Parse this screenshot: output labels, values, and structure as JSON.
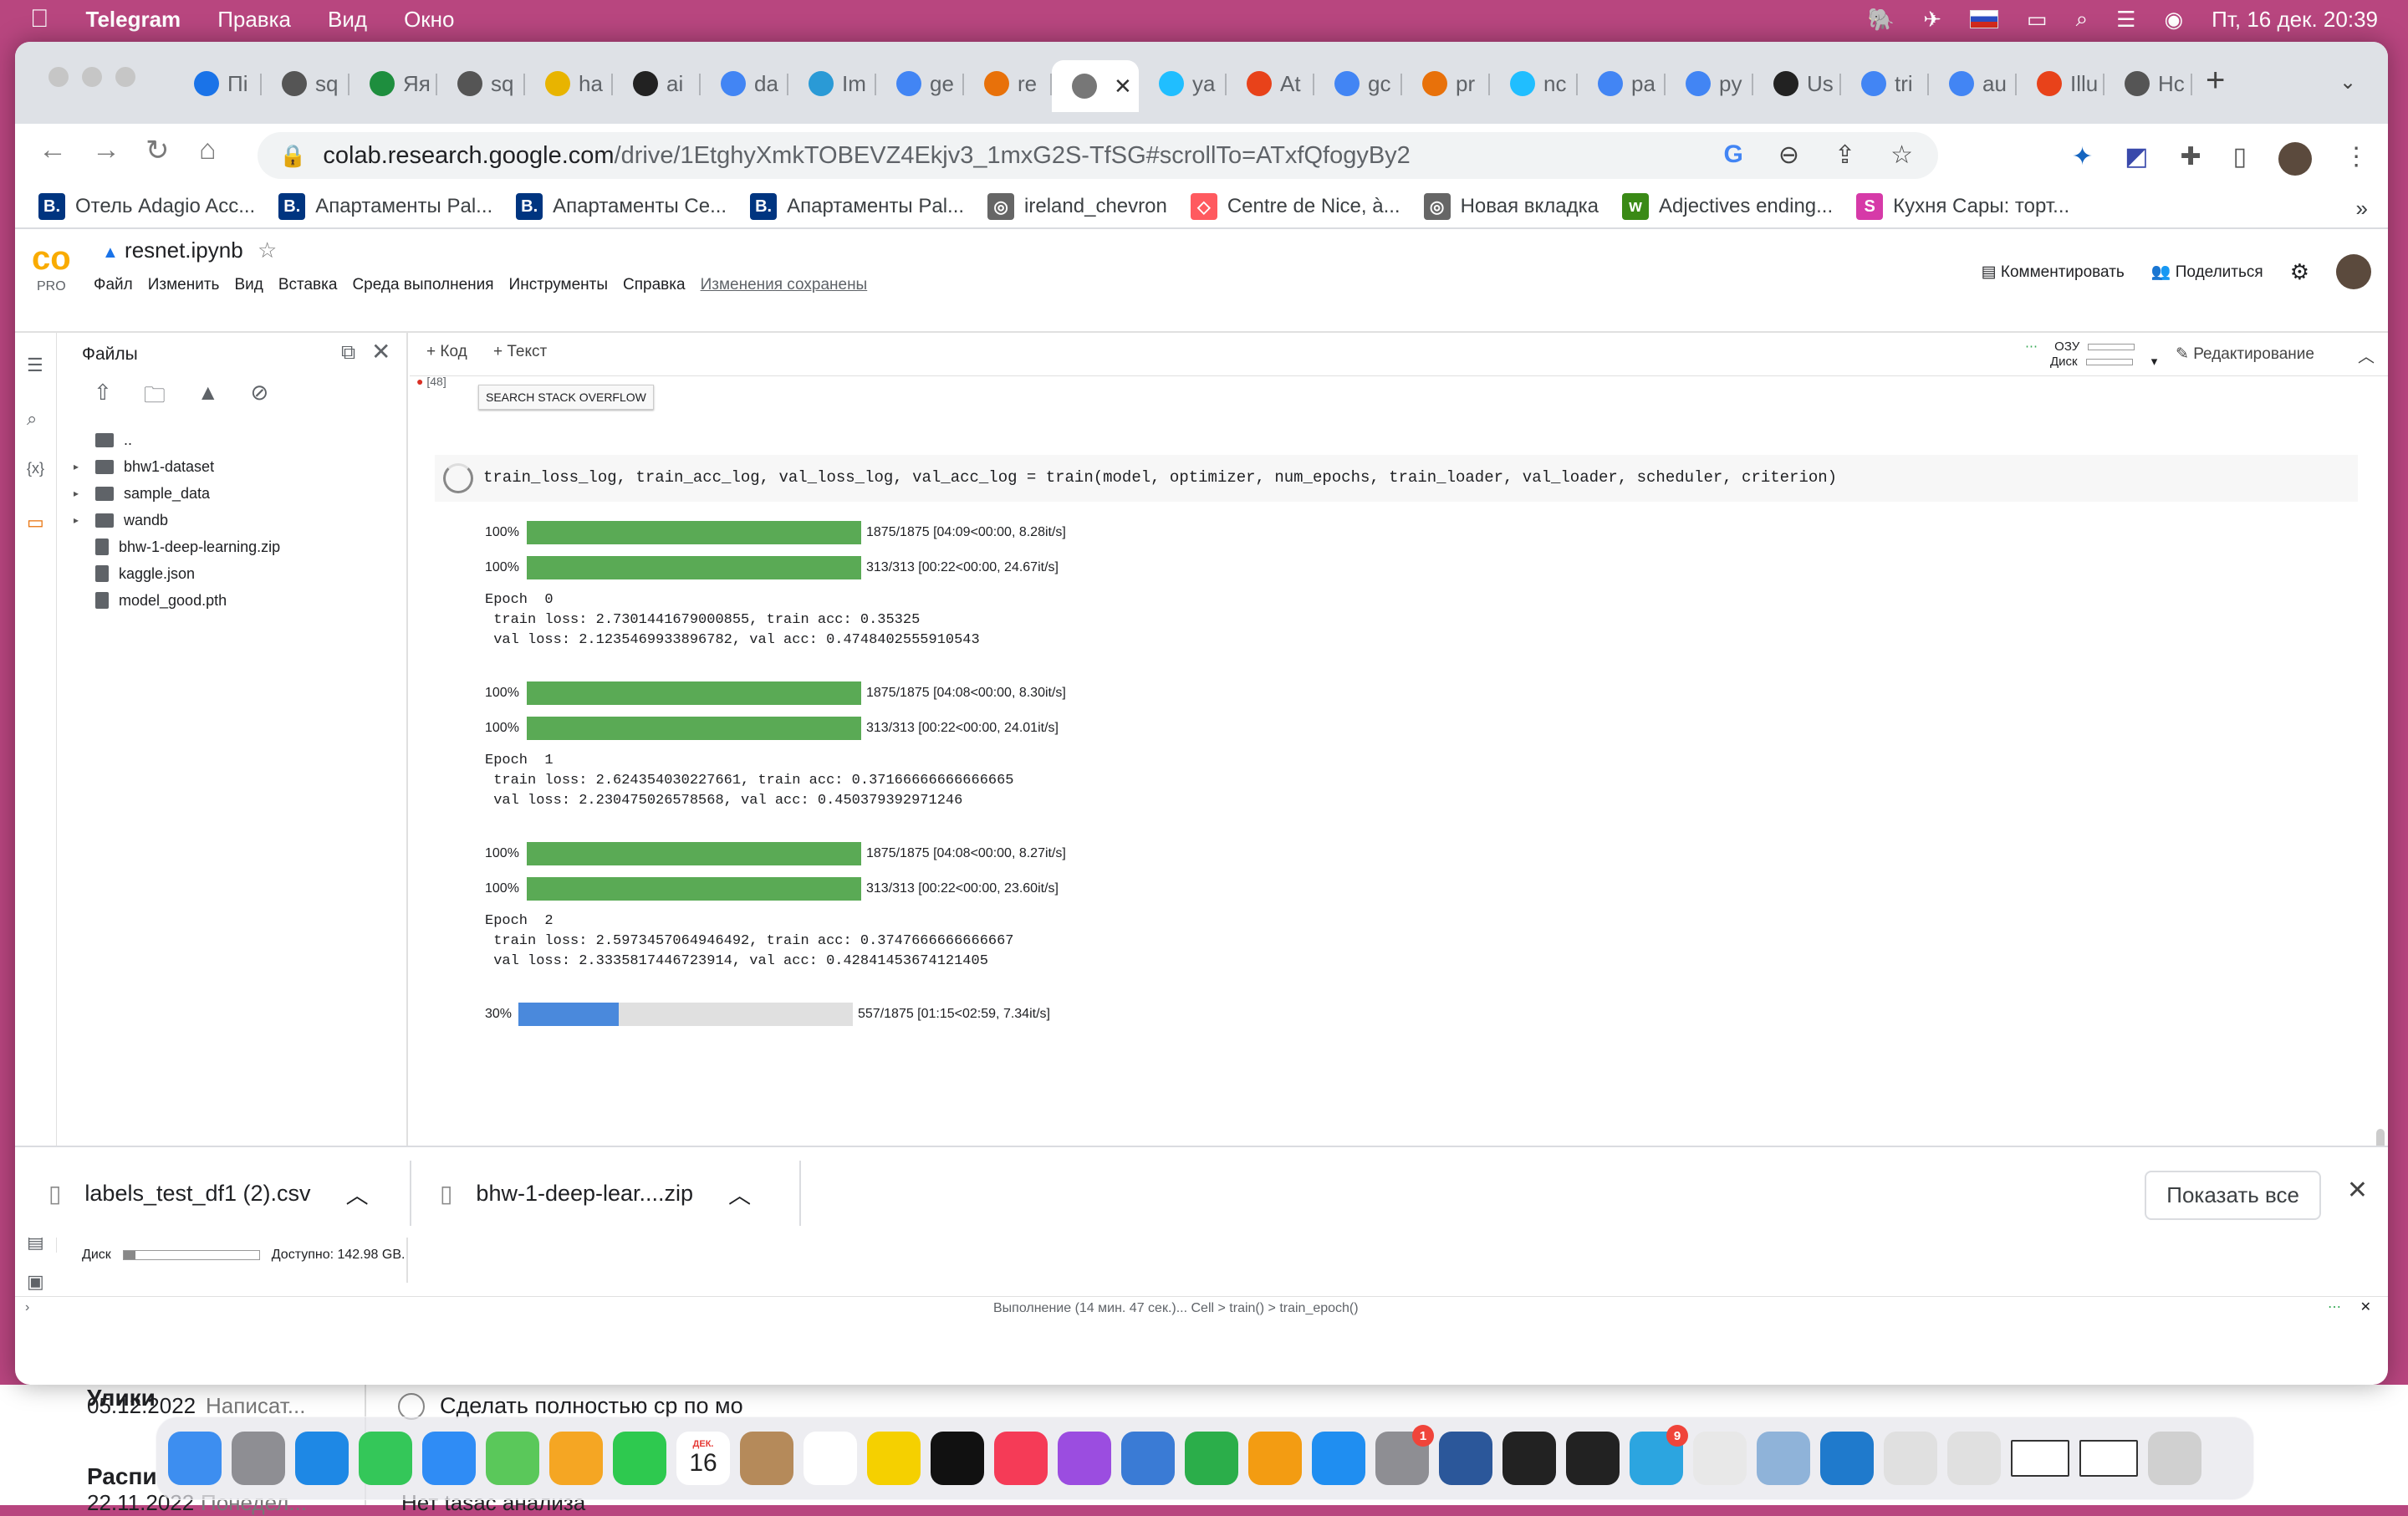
{
  "menubar": {
    "app": "Telegram",
    "items": [
      "Правка",
      "Вид",
      "Окно"
    ],
    "datetime": "Пт, 16 дек.  20:39"
  },
  "tabs": [
    {
      "label": "Пі",
      "icon": "google-drive-icon",
      "color": "#1a73e8"
    },
    {
      "label": "sq",
      "icon": "globe-icon",
      "color": "#555"
    },
    {
      "label": "Яя",
      "icon": "sheets-icon",
      "color": "#1e8e3e"
    },
    {
      "label": "sq",
      "icon": "globe-icon",
      "color": "#555"
    },
    {
      "label": "ha",
      "icon": "dots-icon",
      "color": "#e8b400"
    },
    {
      "label": "ai",
      "icon": "github-icon",
      "color": "#222"
    },
    {
      "label": "da",
      "icon": "google-icon",
      "color": "#4285f4"
    },
    {
      "label": "Im",
      "icon": "p-icon",
      "color": "#2a9ad6"
    },
    {
      "label": "ge",
      "icon": "google-icon",
      "color": "#4285f4"
    },
    {
      "label": "re",
      "icon": "colab-icon",
      "color": "#e8710a"
    },
    {
      "label": "",
      "icon": "colab-icon",
      "color": "#777"
    },
    {
      "label": "ya",
      "icon": "k-icon",
      "color": "#20beff"
    },
    {
      "label": "At",
      "icon": "opera-icon",
      "color": "#e8421a"
    },
    {
      "label": "gc",
      "icon": "google-icon",
      "color": "#4285f4"
    },
    {
      "label": "pr",
      "icon": "colab-icon",
      "color": "#e8710a"
    },
    {
      "label": "nc",
      "icon": "k-icon",
      "color": "#20beff"
    },
    {
      "label": "pa",
      "icon": "google-icon",
      "color": "#4285f4"
    },
    {
      "label": "py",
      "icon": "google-icon",
      "color": "#4285f4"
    },
    {
      "label": "Us",
      "icon": "rm-icon",
      "color": "#222"
    },
    {
      "label": "tri",
      "icon": "google-icon",
      "color": "#4285f4"
    },
    {
      "label": "au",
      "icon": "google-icon",
      "color": "#4285f4"
    },
    {
      "label": "Illu",
      "icon": "opera-icon",
      "color": "#e8421a"
    },
    {
      "label": "Hc",
      "icon": "chrome-icon",
      "color": "#555"
    }
  ],
  "address": {
    "host": "colab.research.google.com",
    "path": "/drive/1EtghyXmkTOBEVZ4Ekjv3_1mxG2S-TfSG#scrollTo=ATxfQfogyBy2"
  },
  "bookmarks": [
    {
      "label": "Отель Adagio Acc...",
      "icon": "B.",
      "color": "#003580"
    },
    {
      "label": "Апартаменты Pal...",
      "icon": "B.",
      "color": "#003580"
    },
    {
      "label": "Апартаменты Се...",
      "icon": "B.",
      "color": "#003580"
    },
    {
      "label": "Апартаменты Pal...",
      "icon": "B.",
      "color": "#003580"
    },
    {
      "label": "ireland_chevron",
      "icon": "◎",
      "color": "#666"
    },
    {
      "label": "Centre de Nice, à...",
      "icon": "◇",
      "color": "#ff5a5f"
    },
    {
      "label": "Новая вкладка",
      "icon": "◎",
      "color": "#666"
    },
    {
      "label": "Adjectives ending...",
      "icon": "w",
      "color": "#3a8a16"
    },
    {
      "label": "Кухня Сары: торт...",
      "icon": "S",
      "color": "#d63aa8"
    }
  ],
  "colab": {
    "notebook": "resnet.ipynb",
    "pro": "PRO",
    "menu": [
      "Файл",
      "Изменить",
      "Вид",
      "Вставка",
      "Среда выполнения",
      "Инструменты",
      "Справка"
    ],
    "saved": "Изменения сохранены",
    "comment": "Комментировать",
    "share": "Поделиться",
    "add_code": "+ Код",
    "add_text": "+ Текст",
    "ram_label": "ОЗУ",
    "disk_label": "Диск",
    "editing": "Редактирование",
    "so_button": "SEARCH STACK OVERFLOW",
    "prev_exec": "[48]",
    "code": "train_loss_log, train_acc_log, val_loss_log, val_acc_log = train(model, optimizer, num_epochs, train_loader, val_loader, scheduler, criterion)",
    "files_title": "Файлы",
    "files": [
      {
        "name": "..",
        "type": "folder",
        "expand": false
      },
      {
        "name": "bhw1-dataset",
        "type": "folder",
        "expand": true
      },
      {
        "name": "sample_data",
        "type": "folder",
        "expand": true
      },
      {
        "name": "wandb",
        "type": "folder",
        "expand": true
      },
      {
        "name": "bhw-1-deep-learning.zip",
        "type": "file",
        "expand": false
      },
      {
        "name": "kaggle.json",
        "type": "file",
        "expand": false
      },
      {
        "name": "model_good.pth",
        "type": "file",
        "expand": false
      }
    ],
    "disk_text": "Диск",
    "disk_free": "Доступно: 142.98 GB.",
    "status": "Выполнение (14 мин. 47 сек.)...  Cell > train() > train_epoch()"
  },
  "output": [
    {
      "bars": [
        {
          "pct": "100%",
          "fill": 1.0,
          "text": "1875/1875 [04:09<00:00, 8.28it/s]"
        },
        {
          "pct": "100%",
          "fill": 1.0,
          "text": "313/313 [00:22<00:00, 24.67it/s]"
        }
      ],
      "log": "Epoch  0\n train loss: 2.7301441679000855, train acc: 0.35325\n val loss: 2.1235469933896782, val acc: 0.4748402555910543"
    },
    {
      "bars": [
        {
          "pct": "100%",
          "fill": 1.0,
          "text": "1875/1875 [04:08<00:00, 8.30it/s]"
        },
        {
          "pct": "100%",
          "fill": 1.0,
          "text": "313/313 [00:22<00:00, 24.01it/s]"
        }
      ],
      "log": "Epoch  1\n train loss: 2.624354030227661, train acc: 0.37166666666666665\n val loss: 2.230475026578568, val acc: 0.450379392971246"
    },
    {
      "bars": [
        {
          "pct": "100%",
          "fill": 1.0,
          "text": "1875/1875 [04:08<00:00, 8.27it/s]"
        },
        {
          "pct": "100%",
          "fill": 1.0,
          "text": "313/313 [00:22<00:00, 23.60it/s]"
        }
      ],
      "log": "Epoch  2\n train loss: 2.5973457064946492, train acc: 0.3747666666666667\n val loss: 2.3335817446723914, val acc: 0.42841453674121405"
    },
    {
      "bars": [
        {
          "pct": "30%",
          "fill": 0.3,
          "text": "557/1875 [01:15<02:59, 7.34it/s]",
          "blue": true
        }
      ],
      "log": ""
    }
  ],
  "downloads": [
    {
      "name": "labels_test_df1 (2).csv"
    },
    {
      "name": "bhw-1-deep-lear....zip"
    }
  ],
  "download_showall": "Показать все",
  "telegram_behind": {
    "name1": "Улики",
    "date1": "05.12.2022",
    "preview1": "Написат...",
    "task": "Сделать полностью ср по мо",
    "name2": "Распи",
    "date2": "22.11.2022",
    "preview2": "Понедел...",
    "task2": "Нет tasac анализа"
  },
  "dock_calendar": {
    "month": "ДЕК.",
    "day": "16"
  },
  "badges": {
    "settings": "1",
    "telegram": "9"
  }
}
